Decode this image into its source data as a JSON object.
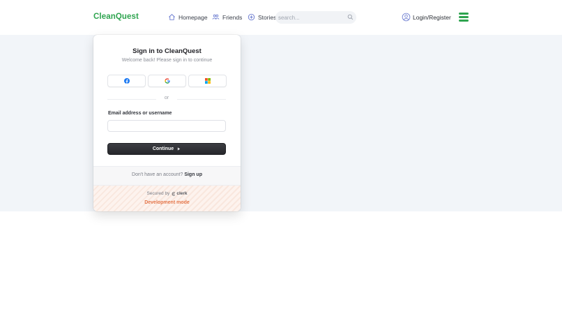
{
  "header": {
    "logo": "CleanQuest",
    "nav": [
      {
        "label": "Homepage",
        "icon": "home-icon"
      },
      {
        "label": "Friends",
        "icon": "users-icon"
      },
      {
        "label": "Stories",
        "icon": "plus-circle-icon"
      }
    ],
    "search": {
      "placeholder": "search...",
      "value": "",
      "icon": "search-icon"
    },
    "login_label": "Login/Register",
    "menu_icon": "hamburger-menu-icon",
    "accent_color": "#2ea44f"
  },
  "signin": {
    "title": "Sign in to CleanQuest",
    "subtitle": "Welcome back! Please sign in to continue",
    "social_providers": [
      "facebook-icon",
      "google-icon",
      "microsoft-icon"
    ],
    "divider_text": "or",
    "email_label": "Email address or username",
    "email_value": "",
    "continue_label": "Continue",
    "no_account_text": "Don't have an account?",
    "signup_label": "Sign up",
    "secured_by": "Secured by",
    "secured_brand": "clerk",
    "dev_mode": "Development mode",
    "dev_mode_color": "#e5764a"
  }
}
